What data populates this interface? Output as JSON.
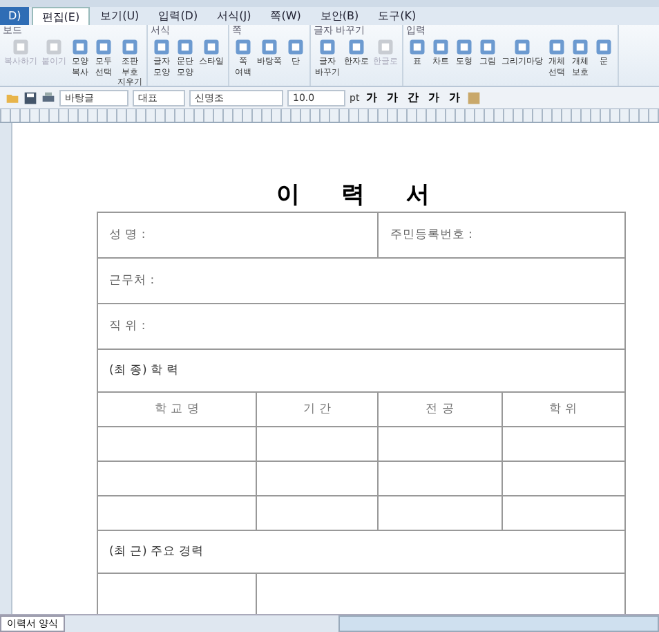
{
  "menu_tabs": [
    {
      "label": "D)",
      "selected": false,
      "kind": "file"
    },
    {
      "label": "편집(E)",
      "selected": true,
      "kind": "tab"
    },
    {
      "label": "보기(U)",
      "selected": false,
      "kind": "tab"
    },
    {
      "label": "입력(D)",
      "selected": false,
      "kind": "tab"
    },
    {
      "label": "서식(J)",
      "selected": false,
      "kind": "tab"
    },
    {
      "label": "쪽(W)",
      "selected": false,
      "kind": "tab"
    },
    {
      "label": "보안(B)",
      "selected": false,
      "kind": "tab"
    },
    {
      "label": "도구(K)",
      "selected": false,
      "kind": "tab"
    }
  ],
  "ribbon_groups": [
    {
      "title": "보드",
      "items": [
        {
          "label": "복사하기",
          "disabled": true
        },
        {
          "label": "붙이기",
          "disabled": true
        },
        {
          "label": "모양 복사",
          "disabled": false
        },
        {
          "label": "모두 선택",
          "disabled": false
        },
        {
          "label": "조판 부호 지우기",
          "disabled": false
        }
      ]
    },
    {
      "title": "서식",
      "items": [
        {
          "label": "글자 모양",
          "disabled": false
        },
        {
          "label": "문단 모양",
          "disabled": false
        },
        {
          "label": "스타일",
          "disabled": false
        }
      ]
    },
    {
      "title": "쪽",
      "items": [
        {
          "label": "쪽 여백",
          "disabled": false
        },
        {
          "label": "바탕쪽",
          "disabled": false
        },
        {
          "label": "단",
          "disabled": false
        }
      ]
    },
    {
      "title": "글자 바꾸기",
      "items": [
        {
          "label": "글자 바꾸기",
          "disabled": false
        },
        {
          "label": "한자로",
          "disabled": false
        },
        {
          "label": "한글로",
          "disabled": true
        }
      ]
    },
    {
      "title": "입력",
      "items": [
        {
          "label": "표",
          "disabled": false
        },
        {
          "label": "차트",
          "disabled": false
        },
        {
          "label": "도형",
          "disabled": false
        },
        {
          "label": "그림",
          "disabled": false
        },
        {
          "label": "그리기마당",
          "disabled": false
        },
        {
          "label": "개체 선택",
          "disabled": false
        },
        {
          "label": "개체 보호",
          "disabled": false
        },
        {
          "label": "문",
          "disabled": false
        }
      ]
    }
  ],
  "toolbar": {
    "style": "바탕글",
    "language": "대표",
    "font": "신명조",
    "size": "10.0",
    "unit": "pt",
    "format_buttons": [
      "가",
      "가",
      "간",
      "가",
      "가"
    ]
  },
  "document": {
    "title": "이 력 서",
    "fields": [
      {
        "label": "성  명 :"
      },
      {
        "label": "주민등록번호 :"
      },
      {
        "label": "근무처 :"
      },
      {
        "label": "직  위 :"
      }
    ],
    "education_heading": "(최 종) 학  력",
    "education_columns": [
      "학  교  명",
      "기    간",
      "전    공",
      "학    위"
    ],
    "career_heading": "(최 근) 주요 경력"
  },
  "status_bar": {
    "sheet_tab": "이력서 양식"
  }
}
